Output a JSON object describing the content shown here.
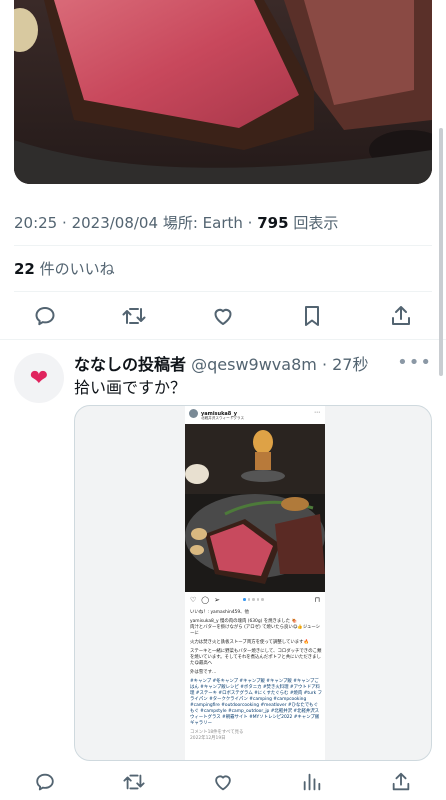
{
  "tweet": {
    "time": "20:25",
    "date": "2023/08/04",
    "location_label": "場所:",
    "location": "Earth",
    "views_count": "795",
    "views_label": "回表示",
    "likes_count": "22",
    "likes_label": "件のいいね"
  },
  "actions": [
    {
      "icon": "reply-icon"
    },
    {
      "icon": "retweet-icon"
    },
    {
      "icon": "like-icon"
    },
    {
      "icon": "bookmark-icon"
    },
    {
      "icon": "share-icon"
    }
  ],
  "reply": {
    "avatar_glyph": "❤",
    "name": "ななしの投稿者",
    "handle": "@qesw9wva8m",
    "age": "27秒",
    "more_glyph": "•••",
    "text": "拾い画ですか？",
    "embed": {
      "username": "yamisuka8_y",
      "location": "北軽井沢スウィートグラス",
      "likes_text": "いいね！: yamashin459、他",
      "caption_1": "yamisuka8_y 慢の肉の塊肉 (630g) を焼きました 🍖\n肉汁とバターを掛けながら (アロゼ) て焼いたら良い😋👍ジューシーに",
      "caption_2": "火力は焚き火と鉄板ストーブ両方を使って調整しています🔥",
      "caption_3": "ステーキと一緒に野菜もバター焼きにして、コロダッチできのこ類を焼いています。そしてそれを煮込んだポトフと共にいただきました😋最高へ",
      "caption_4": "外は雪です…",
      "tags": "#キャンプ #冬キャンプ #キャンプ飯 #キャンプ飯 #キャンプごはん #キャンプ飯レシピ #ボタニカ #焚き火料理 #アウトドア料理 #ステーキ #ロボステグラム #にくすたぐらむ #焼肉 #turk フライパン #ターククライパン #camping #campcooking #campingfire #outdoorcooking #meatlover #ひなたでもぐもぐ #campstyle #camp_outdoor_jp #北軽井沢 #北軽井沢スウィートグラス #朝霧サイト #MYソトレシピ2022 #キャンプ飯ギャラリー",
      "comments_text": "コメント18件をすべて見る",
      "date_text": "2022年12月19日"
    }
  },
  "bottom_actions": [
    {
      "icon": "reply-icon"
    },
    {
      "icon": "retweet-icon"
    },
    {
      "icon": "like-icon"
    },
    {
      "icon": "views-icon"
    },
    {
      "icon": "share-icon"
    }
  ]
}
